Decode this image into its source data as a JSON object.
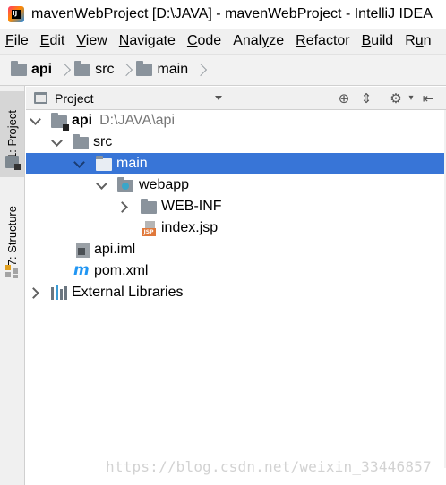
{
  "window": {
    "title": "mavenWebProject [D:\\JAVA] - mavenWebProject - IntelliJ IDEA"
  },
  "menubar": {
    "items": [
      {
        "mnemonic": "F",
        "rest": "ile"
      },
      {
        "mnemonic": "E",
        "rest": "dit"
      },
      {
        "mnemonic": "V",
        "rest": "iew"
      },
      {
        "mnemonic": "N",
        "rest": "avigate"
      },
      {
        "mnemonic": "C",
        "rest": "ode"
      },
      {
        "pre": "Anal",
        "mnemonic": "y",
        "rest": "ze"
      },
      {
        "mnemonic": "R",
        "rest": "efactor"
      },
      {
        "mnemonic": "B",
        "rest": "uild"
      },
      {
        "pre": "R",
        "mnemonic": "u",
        "rest": "n"
      }
    ]
  },
  "breadcrumb": [
    "api",
    "src",
    "main"
  ],
  "toolwindow_strip": {
    "project_tab": "1: Project",
    "structure_tab": "7: Structure"
  },
  "project_panel": {
    "view_selector": "Project",
    "icons": [
      "locate-icon",
      "collapse-all-icon",
      "settings-icon",
      "hide-icon"
    ]
  },
  "tree": {
    "api": {
      "name": "api",
      "path": "D:\\JAVA\\api"
    },
    "src": "src",
    "main": "main",
    "webapp": "webapp",
    "webinf": "WEB-INF",
    "indexjsp": "index.jsp",
    "apiiml": "api.iml",
    "pomxml": "pom.xml",
    "extlibs": "External Libraries",
    "selected": "main",
    "jsp_badge": "JSP"
  },
  "colors": {
    "selection": "#3875d7",
    "maven_icon": "#2196f3",
    "jsp_icon": "#e0783a"
  },
  "watermark": "https://blog.csdn.net/weixin_33446857"
}
